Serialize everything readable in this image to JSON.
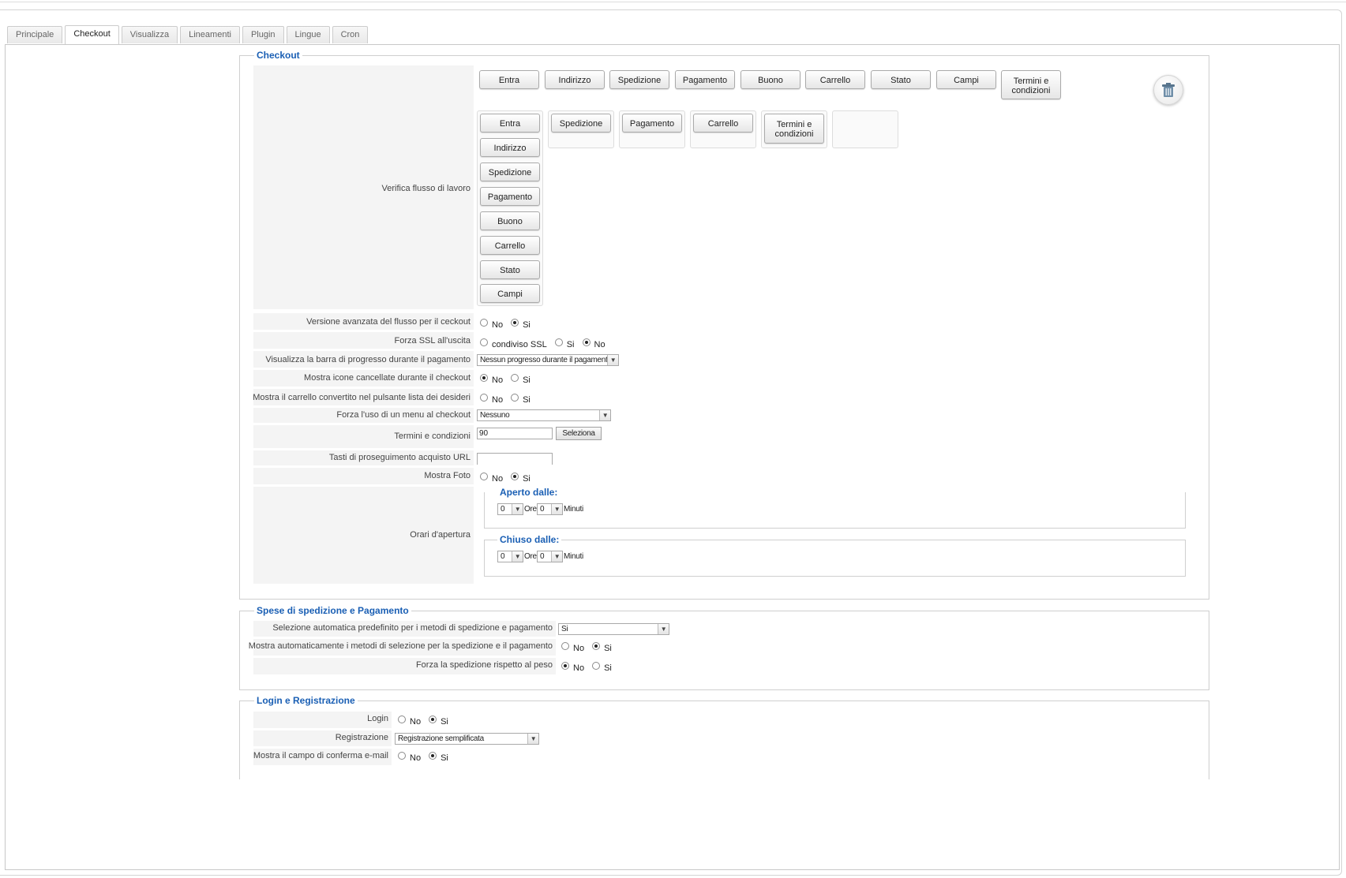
{
  "tabs": [
    {
      "label": "Principale",
      "active": false
    },
    {
      "label": "Checkout",
      "active": true
    },
    {
      "label": "Visualizza",
      "active": false
    },
    {
      "label": "Lineamenti",
      "active": false
    },
    {
      "label": "Plugin",
      "active": false
    },
    {
      "label": "Lingue",
      "active": false
    },
    {
      "label": "Cron",
      "active": false
    }
  ],
  "checkout": {
    "legend": "Checkout",
    "workflow_label": "Verifica flusso di lavoro",
    "available_steps": [
      "Entra",
      "Indirizzo",
      "Spedizione",
      "Pagamento",
      "Buono",
      "Carrello",
      "Stato",
      "Campi",
      "Termini e condizioni"
    ],
    "column1": [
      "Entra",
      "Indirizzo",
      "Spedizione",
      "Pagamento",
      "Buono",
      "Carrello",
      "Stato",
      "Campi"
    ],
    "column2": [
      "Spedizione"
    ],
    "column3": [
      "Pagamento"
    ],
    "column4": [
      "Carrello"
    ],
    "column5": [
      "Termini e condizioni"
    ],
    "trash_icon": "trash-icon",
    "advanced_flow": {
      "label": "Versione avanzata del flusso per il ceckout",
      "options": [
        "No",
        "Si"
      ],
      "selected": "Si"
    },
    "force_ssl": {
      "label": "Forza SSL all'uscita",
      "options": [
        "condiviso SSL",
        "Si",
        "No"
      ],
      "selected": "No"
    },
    "progress_bar": {
      "label": "Visualizza la barra di progresso durante il pagamento",
      "value": "Nessun progresso durante il pagamento"
    },
    "show_cancelled_icons": {
      "label": "Mostra icone cancellate durante il checkout",
      "options": [
        "No",
        "Si"
      ],
      "selected": "No"
    },
    "cart_to_wishlist": {
      "label": "Mostra il carrello convertito nel pulsante lista dei desideri",
      "options": [
        "No",
        "Si"
      ],
      "selected": "none"
    },
    "force_menu": {
      "label": "Forza l'uso di un menu al checkout",
      "value": "Nessuno"
    },
    "terms": {
      "label": "Termini e condizioni",
      "value": "90",
      "button": "Seleziona"
    },
    "continue_url": {
      "label": "Tasti di proseguimento acquisto URL",
      "value": ""
    },
    "show_photo": {
      "label": "Mostra Foto",
      "options": [
        "No",
        "Si"
      ],
      "selected": "Si"
    },
    "opening_hours": {
      "label": "Orari d'apertura",
      "open_legend": "Aperto dalle:",
      "close_legend": "Chiuso dalle:",
      "hours_unit": "Ore",
      "minutes_unit": "Minuti",
      "open_hour": "0",
      "open_min": "0",
      "close_hour": "0",
      "close_min": "0"
    }
  },
  "shipping": {
    "legend": "Spese di spedizione e Pagamento",
    "auto_select": {
      "label": "Selezione automatica predefinito per i metodi di spedizione e pagamento",
      "value": "Si"
    },
    "auto_show": {
      "label": "Mostra automaticamente i metodi di selezione per la spedizione e il pagamento",
      "options": [
        "No",
        "Si"
      ],
      "selected": "Si"
    },
    "force_weight": {
      "label": "Forza la spedizione rispetto al peso",
      "options": [
        "No",
        "Si"
      ],
      "selected": "No"
    }
  },
  "login": {
    "legend": "Login e Registrazione",
    "login": {
      "label": "Login",
      "options": [
        "No",
        "Si"
      ],
      "selected": "Si"
    },
    "registration": {
      "label": "Registrazione",
      "value": "Registrazione semplificata"
    },
    "email_confirm": {
      "label": "Mostra il campo di conferma e-mail",
      "options": [
        "No",
        "Si"
      ],
      "selected": "Si"
    }
  }
}
